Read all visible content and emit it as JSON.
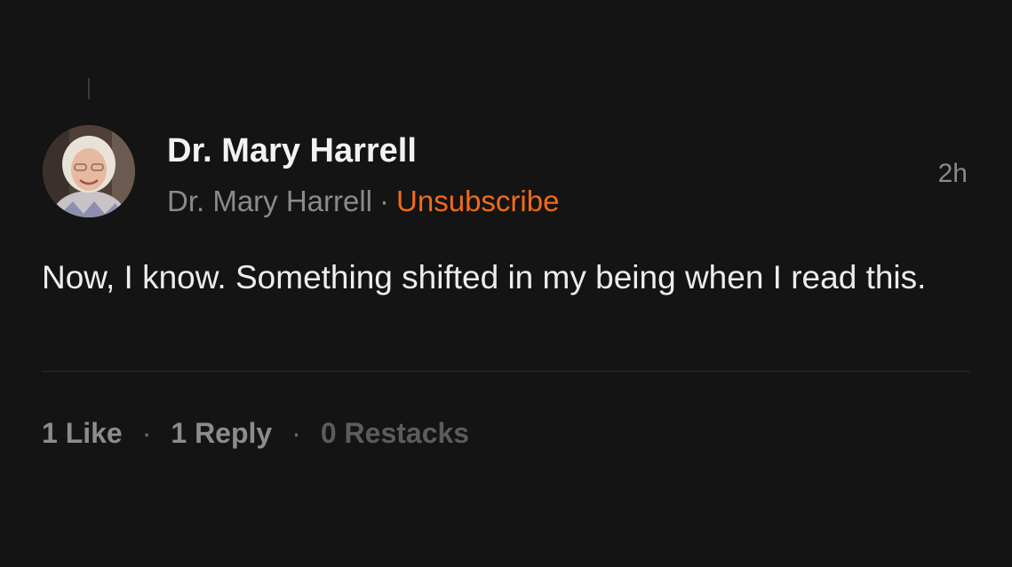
{
  "comment": {
    "author_name": "Dr. Mary Harrell",
    "publication_name": "Dr. Mary Harrell",
    "separator": "·",
    "unsubscribe_label": "Unsubscribe",
    "timestamp": "2h",
    "body": "Now, I know. Something shifted in my being when I read this."
  },
  "actions": {
    "likes": "1 Like",
    "replies": "1 Reply",
    "restacks": "0 Restacks",
    "separator": "·"
  },
  "colors": {
    "background": "#141414",
    "accent": "#f26a1b",
    "secondary_text": "#8a8a8a"
  },
  "icons": {
    "avatar": "avatar-photo"
  }
}
